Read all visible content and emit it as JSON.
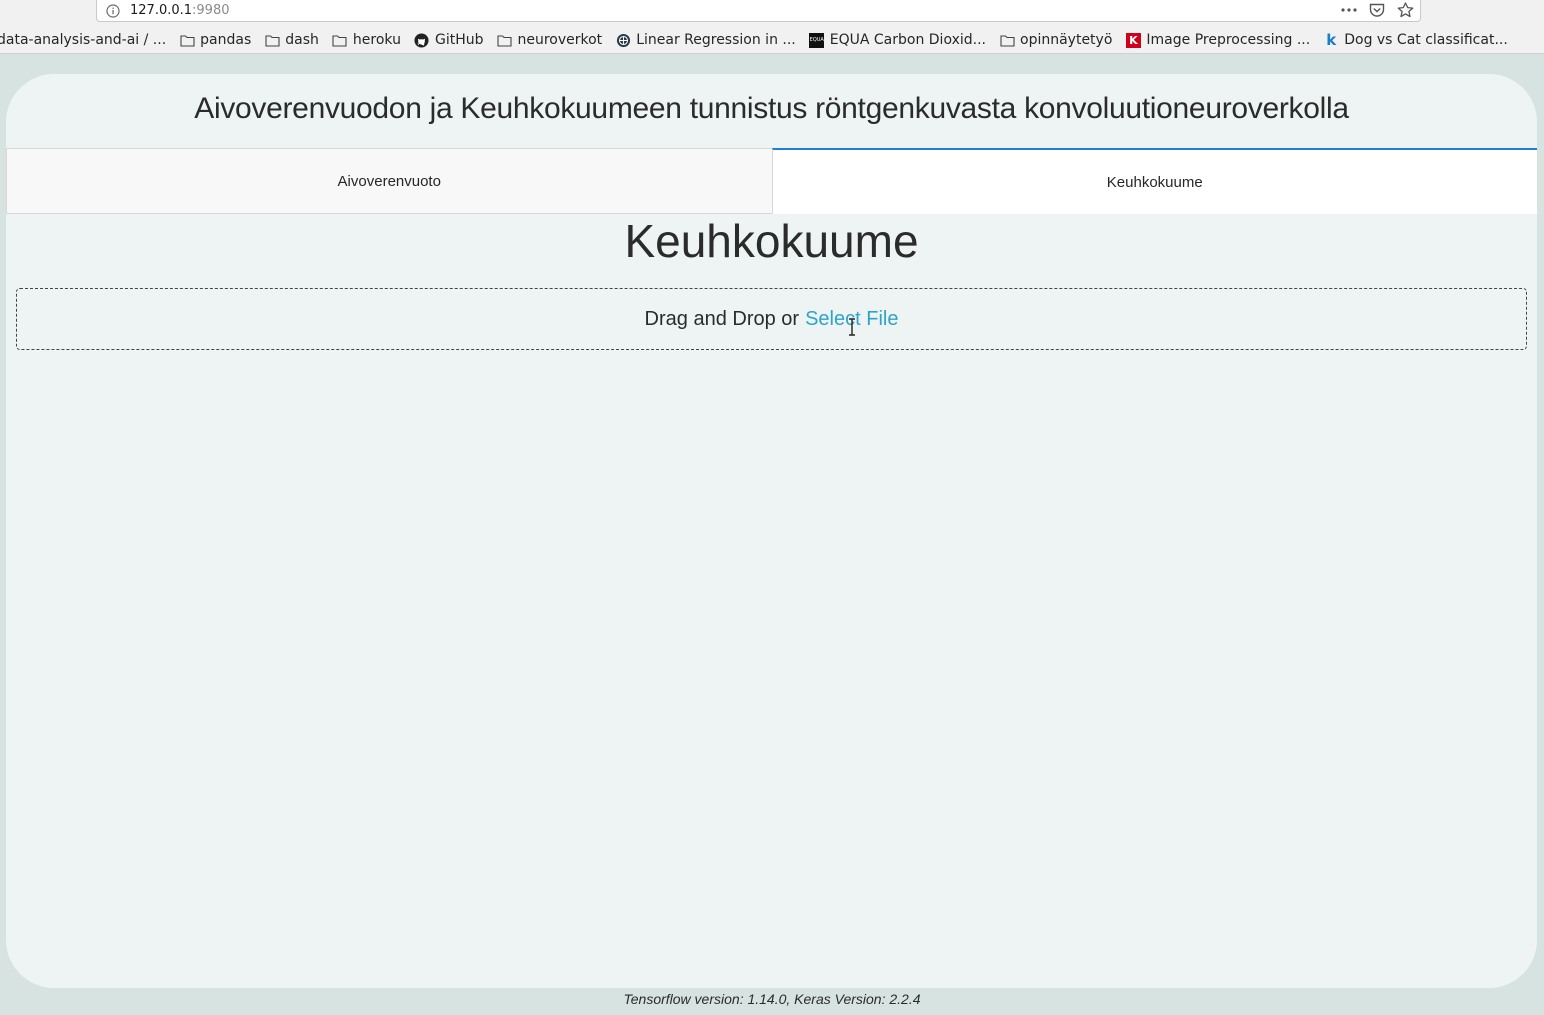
{
  "browser": {
    "url_host": "127.0.0.1",
    "url_port": ":9980",
    "bookmarks": [
      {
        "label": "data-analysis-and-ai / ...",
        "icon": "none"
      },
      {
        "label": "pandas",
        "icon": "folder-icon"
      },
      {
        "label": "dash",
        "icon": "folder-icon"
      },
      {
        "label": "heroku",
        "icon": "folder-icon"
      },
      {
        "label": "GitHub",
        "icon": "github-icon"
      },
      {
        "label": "neuroverkot",
        "icon": "folder-icon"
      },
      {
        "label": "Linear Regression in ...",
        "icon": "globe-icon"
      },
      {
        "label": "EQUA Carbon Dioxid...",
        "icon": "equa-icon"
      },
      {
        "label": "opinnäytetyö",
        "icon": "folder-icon"
      },
      {
        "label": "Image Preprocessing ...",
        "icon": "k-red-icon"
      },
      {
        "label": "Dog vs Cat classificat...",
        "icon": "kaggle-icon"
      }
    ]
  },
  "app": {
    "title": "Aivoverenvuodon ja Keuhkokuumeen tunnistus röntgenkuvasta konvoluutioneuroverkolla",
    "tabs": [
      {
        "label": "Aivoverenvuoto",
        "active": false
      },
      {
        "label": "Keuhkokuume",
        "active": true
      }
    ],
    "section_title": "Keuhkokuume",
    "upload": {
      "prefix": "Drag and Drop or",
      "link": "Select File"
    },
    "footer": "Tensorflow version: 1.14.0, Keras Version: 2.2.4"
  },
  "colors": {
    "accent": "#1f7ed8",
    "link": "#2fa4c8",
    "background": "#d6e3e1",
    "panel": "#eef4f3"
  }
}
